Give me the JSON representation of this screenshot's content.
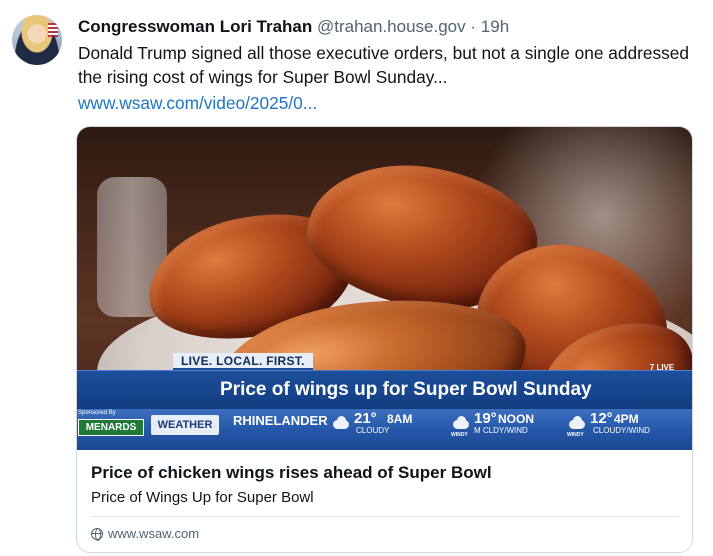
{
  "post": {
    "author": "Congresswoman Lori Trahan",
    "handle": "@trahan.house.gov",
    "separator": "·",
    "timestamp": "19h",
    "text": "Donald Trump signed all those executive orders, but not a single one addressed the rising cost of wings for Super Bowl Sunday...",
    "link": "www.wsaw.com/video/2025/0..."
  },
  "card": {
    "thumbnail": {
      "live_tag": "LIVE. LOCAL. FIRST.",
      "headline": "Price of wings up for Super Bowl Sunday",
      "corner_logo": "7 LIVE",
      "ticker": {
        "sponsor_label": "Sponsored By",
        "sponsor": "MENARDS",
        "weather_label": "WEATHER",
        "city": "RHINELANDER",
        "forecast": [
          {
            "icon": "cloud-icon",
            "tag": "",
            "temp": "21°",
            "when": "8AM",
            "condition": "CLOUDY"
          },
          {
            "icon": "windy-cloud-icon",
            "tag": "WINDY",
            "temp": "19°",
            "when": "NOON",
            "condition": "M CLDY/WIND"
          },
          {
            "icon": "windy-cloud-icon",
            "tag": "WINDY",
            "temp": "12°",
            "when": "4PM",
            "condition": "CLOUDY/WIND"
          }
        ]
      }
    },
    "title": "Price of chicken wings rises ahead of Super Bowl",
    "description": "Price of Wings Up for Super Bowl",
    "domain_icon": "globe-icon",
    "domain": "www.wsaw.com"
  },
  "colors": {
    "link": "#1d74c4",
    "secondary_text": "#536471",
    "news_blue": "#1d4f9c",
    "sponsor_green": "#1f7a3a"
  }
}
